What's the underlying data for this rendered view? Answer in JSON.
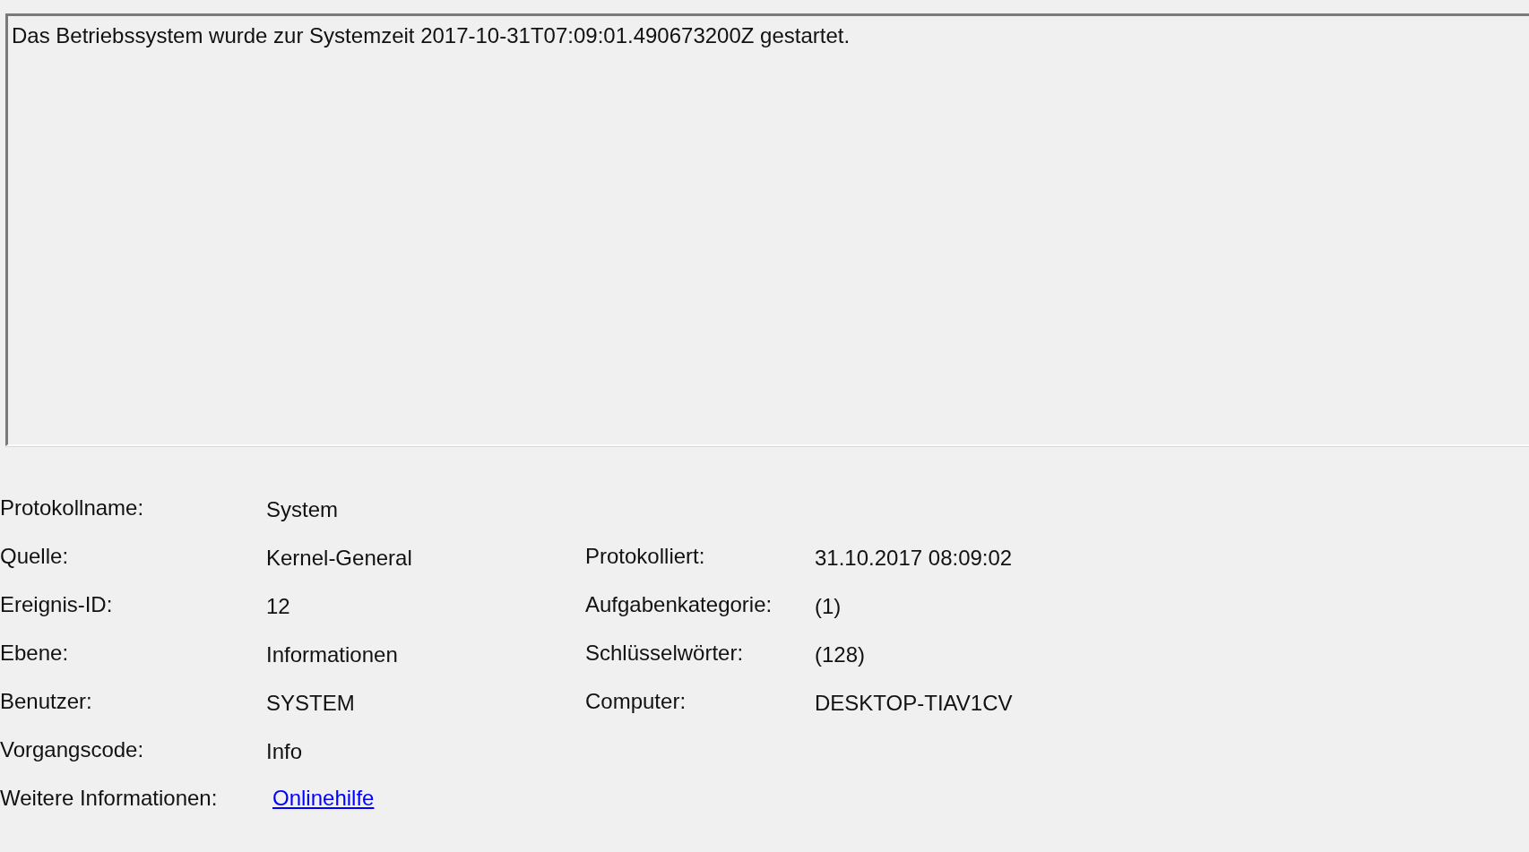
{
  "description": "Das Betriebssystem wurde zur Systemzeit 2017-10-31T07:09:01.490673200Z gestartet.",
  "rows": [
    {
      "left": {
        "label": "Protokollname:",
        "value": "System"
      }
    },
    {
      "left": {
        "label": "Quelle:",
        "value": "Kernel-General"
      },
      "right": {
        "label": "Protokolliert:",
        "value": "31.10.2017 08:09:02"
      }
    },
    {
      "left": {
        "label": "Ereignis-ID:",
        "value": "12"
      },
      "right": {
        "label": "Aufgabenkategorie:",
        "value": "(1)"
      }
    },
    {
      "left": {
        "label": "Ebene:",
        "value": "Informationen"
      },
      "right": {
        "label": "Schlüsselwörter:",
        "value": "(128)"
      }
    },
    {
      "left": {
        "label": "Benutzer:",
        "value": "SYSTEM"
      },
      "right": {
        "label": "Computer:",
        "value": "DESKTOP-TIAV1CV"
      }
    },
    {
      "left": {
        "label": "Vorgangscode:",
        "value": "Info"
      }
    },
    {
      "left": {
        "label": "Weitere Informationen:",
        "value": "Onlinehilfe",
        "kind": "link"
      }
    }
  ]
}
